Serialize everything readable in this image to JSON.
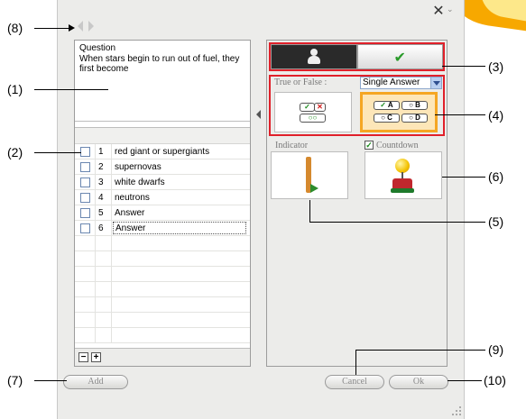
{
  "question": {
    "heading": "Question",
    "text": "When stars begin to run out of fuel, they first become"
  },
  "answers": [
    {
      "num": "1",
      "text": "red giant or supergiants"
    },
    {
      "num": "2",
      "text": "supernovas"
    },
    {
      "num": "3",
      "text": "white dwarfs"
    },
    {
      "num": "4",
      "text": "neutrons"
    },
    {
      "num": "5",
      "text": "Answer"
    },
    {
      "num": "6",
      "text": "Answer"
    }
  ],
  "type_section": {
    "true_false_label": "True or False :",
    "answer_mode_selected": "Single Answer",
    "mc_labels": [
      "A",
      "B",
      "C",
      "D"
    ]
  },
  "options": {
    "indicator_label": "Indicator",
    "countdown_label": "Countdown",
    "countdown_checked": true
  },
  "buttons": {
    "add": "Add",
    "cancel": "Cancel",
    "ok": "Ok"
  },
  "callouts": {
    "c1": "(1)",
    "c2": "(2)",
    "c3": "(3)",
    "c4": "(4)",
    "c5": "(5)",
    "c6": "(6)",
    "c7": "(7)",
    "c8": "(8)",
    "c9": "(9)",
    "c10": "(10)"
  },
  "colors": {
    "highlight_red": "#e0202a",
    "selected_orange": "#f5a623",
    "accent_corner": "#f7a800"
  }
}
